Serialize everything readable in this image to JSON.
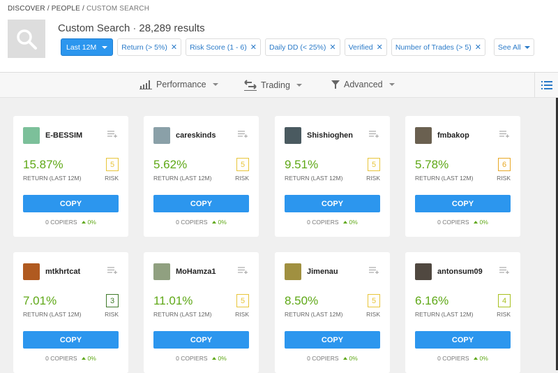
{
  "breadcrumb": [
    "DISCOVER",
    "PEOPLE",
    "CUSTOM SEARCH"
  ],
  "header": {
    "title": "Custom Search",
    "results": "28,289 results"
  },
  "filters": {
    "period": "Last 12M",
    "chips": [
      "Return (> 5%)",
      "Risk Score (1 - 6)",
      "Daily DD (< 25%)",
      "Verified",
      "Number of Trades (> 5)"
    ],
    "see_all": "See All"
  },
  "toolbar": {
    "performance": "Performance",
    "trading": "Trading",
    "advanced": "Advanced"
  },
  "card_labels": {
    "return": "RETURN (LAST 12M)",
    "risk": "RISK",
    "copy": "COPY",
    "copiers": "COPIERS"
  },
  "traders": [
    {
      "name": "E-BESSIM",
      "return": "15.87%",
      "risk": "5",
      "copiers": "0",
      "change": "0%",
      "risk_color": "#e8c53a",
      "avatar": "#7cc09a"
    },
    {
      "name": "careskinds",
      "return": "5.62%",
      "risk": "5",
      "copiers": "0",
      "change": "0%",
      "risk_color": "#e8c53a",
      "avatar": "#8aa0a8"
    },
    {
      "name": "Shishioghen",
      "return": "9.51%",
      "risk": "5",
      "copiers": "0",
      "change": "0%",
      "risk_color": "#e8c53a",
      "avatar": "#4a5a60"
    },
    {
      "name": "fmbakop",
      "return": "5.78%",
      "risk": "6",
      "copiers": "0",
      "change": "0%",
      "risk_color": "#e8a825",
      "avatar": "#6a6050"
    },
    {
      "name": "mtkhrtcat",
      "return": "7.01%",
      "risk": "3",
      "copiers": "0",
      "change": "0%",
      "risk_color": "#3f7a2a",
      "avatar": "#b05a20"
    },
    {
      "name": "MoHamza1",
      "return": "11.01%",
      "risk": "5",
      "copiers": "0",
      "change": "0%",
      "risk_color": "#e8c53a",
      "avatar": "#90a080"
    },
    {
      "name": "Jimenau",
      "return": "8.50%",
      "risk": "5",
      "copiers": "0",
      "change": "0%",
      "risk_color": "#e8c53a",
      "avatar": "#a09040"
    },
    {
      "name": "antonsum09",
      "return": "6.16%",
      "risk": "4",
      "copiers": "0",
      "change": "0%",
      "risk_color": "#a8c020",
      "avatar": "#504840"
    }
  ]
}
